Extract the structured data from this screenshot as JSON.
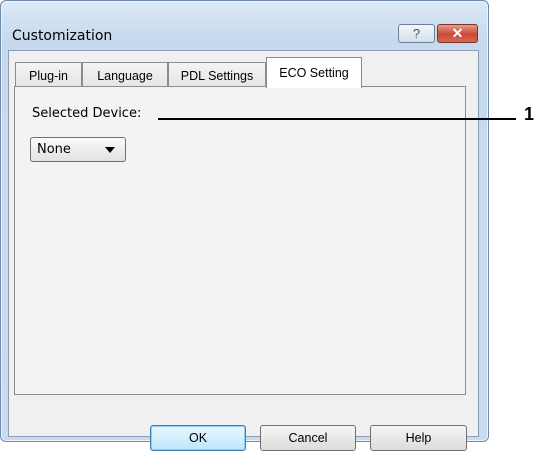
{
  "window": {
    "title": "Customization",
    "help_glyph": "?",
    "close_glyph": "✕"
  },
  "tabs": [
    {
      "label": "Plug-in",
      "active": false
    },
    {
      "label": "Language",
      "active": false
    },
    {
      "label": "PDL Settings",
      "active": false
    },
    {
      "label": "ECO Setting",
      "active": true
    }
  ],
  "panel": {
    "device_label": "Selected Device:",
    "device_value": "None",
    "callout_number": "1"
  },
  "buttons": {
    "ok": "OK",
    "cancel": "Cancel",
    "help": "Help"
  }
}
